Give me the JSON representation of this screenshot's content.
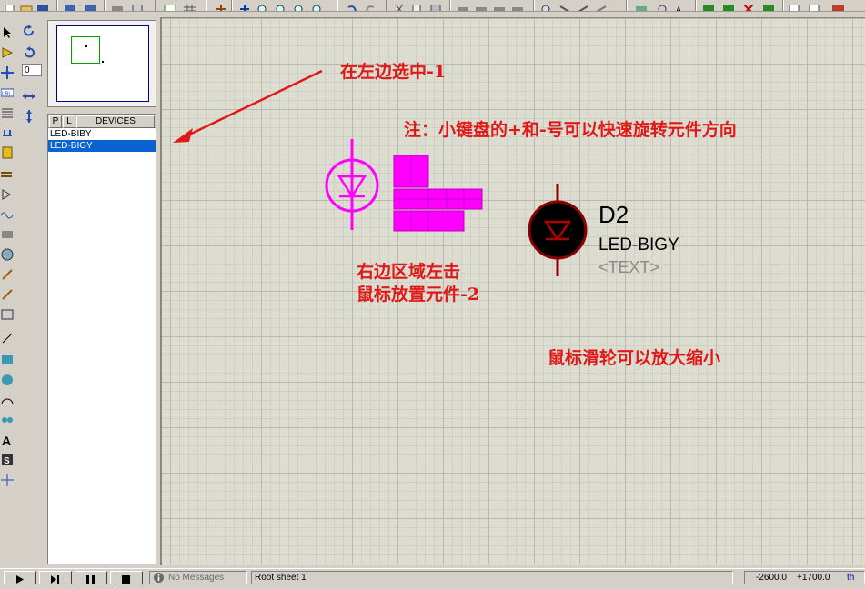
{
  "overview": {
    "label": "overview"
  },
  "rotation": {
    "angle": "0"
  },
  "device_panel": {
    "tab_p": "P",
    "tab_l": "L",
    "header": "DEVICES",
    "items": [
      "LED-BIBY",
      "LED-BIGY"
    ],
    "selected_index": 1
  },
  "canvas": {
    "annotations": {
      "select_left": "在左边选中-1",
      "rotate_tip": "注：小键盘的+和-号可以快速旋转元件方向",
      "place_line1": "右边区域左击",
      "place_line2": "鼠标放置元件-2",
      "zoom_tip": "鼠标滑轮可以放大缩小"
    },
    "component": {
      "ref": "D2",
      "value": "LED-BIGY",
      "text": "<TEXT>"
    },
    "colors": {
      "annotation": "#e01818",
      "ghost": "#ff00ff",
      "component_body": "#8b0000",
      "grid": "#dcdcd0"
    }
  },
  "status": {
    "messages": "No Messages",
    "sheet": "Root sheet 1",
    "coord_x": "-2600.0",
    "coord_y": "+1700.0",
    "units": "th"
  }
}
